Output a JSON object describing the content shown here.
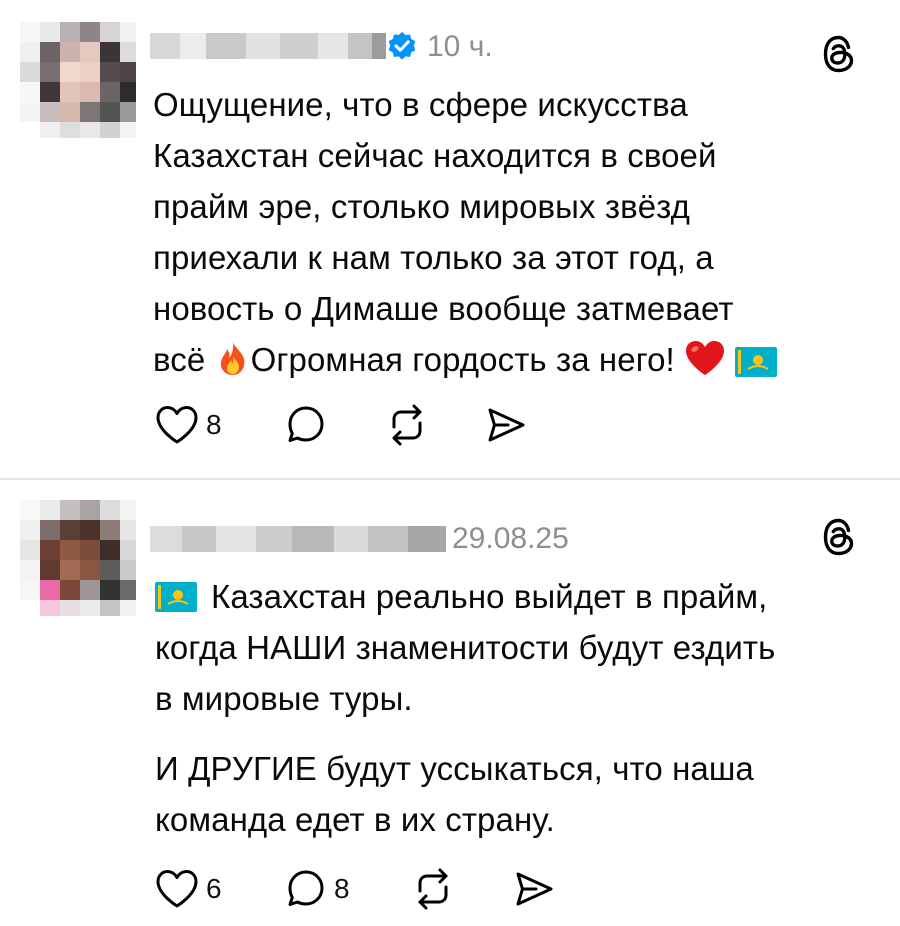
{
  "posts": [
    {
      "time": "10 ч.",
      "lines": [
        "Ощущение, что в сфере искусства",
        "Казахстан сейчас находится в своей",
        "прайм эре, столько мировых звёзд",
        "приехали к нам только за этот год, а",
        "новость о Димаше вообще затмевает"
      ],
      "last_line_a": "всё",
      "last_line_b": "Огромная гордость за него!",
      "likes": "8",
      "replies": ""
    },
    {
      "time": "29.08.25",
      "line1": "Казахстан реально выйдет в прайм,",
      "lines": [
        "когда НАШИ знаменитости будут ездить",
        "в мировые туры."
      ],
      "para2": [
        "И ДРУГИЕ будут уссыкаться, что наша",
        "команда едет в их страну."
      ],
      "likes": "6",
      "replies": "8"
    }
  ],
  "colors": {
    "accent_verified": "#0095f6",
    "timestamp": "#8e8e8e",
    "divider": "#e4e4e4",
    "flag_kz": "#00afca",
    "flag_emblem": "#fec50c"
  },
  "icons": [
    "verified-badge-icon",
    "threads-logo-icon",
    "heart-icon",
    "comment-icon",
    "repost-icon",
    "share-icon",
    "fire-emoji",
    "red-heart-emoji",
    "kazakhstan-flag-emoji"
  ]
}
